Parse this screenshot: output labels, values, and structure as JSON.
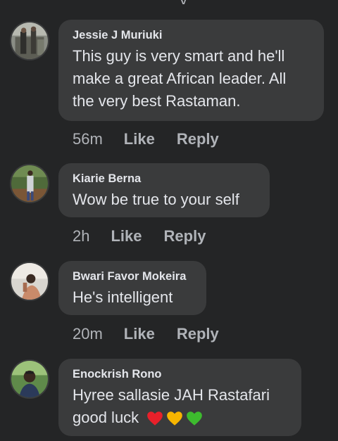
{
  "comments": [
    {
      "author": "Jessie J Muriuki",
      "lines": [
        "This guy is very smart and he'll",
        "make a great African leader. All",
        "the very best Rastaman."
      ],
      "time": "56m",
      "like": "Like",
      "reply": "Reply"
    },
    {
      "author": "Kiarie Berna",
      "lines": [
        "Wow be true to your self"
      ],
      "time": "2h",
      "like": "Like",
      "reply": "Reply"
    },
    {
      "author": "Bwari Favor Mokeira",
      "lines": [
        "He's intelligent"
      ],
      "time": "20m",
      "like": "Like",
      "reply": "Reply"
    },
    {
      "author": "Enockrish Rono",
      "lines": [
        "Hyree sallasie JAH Rastafari",
        "good luck"
      ],
      "emojis": [
        "red-heart-icon",
        "yellow-heart-icon",
        "green-heart-icon"
      ]
    }
  ]
}
